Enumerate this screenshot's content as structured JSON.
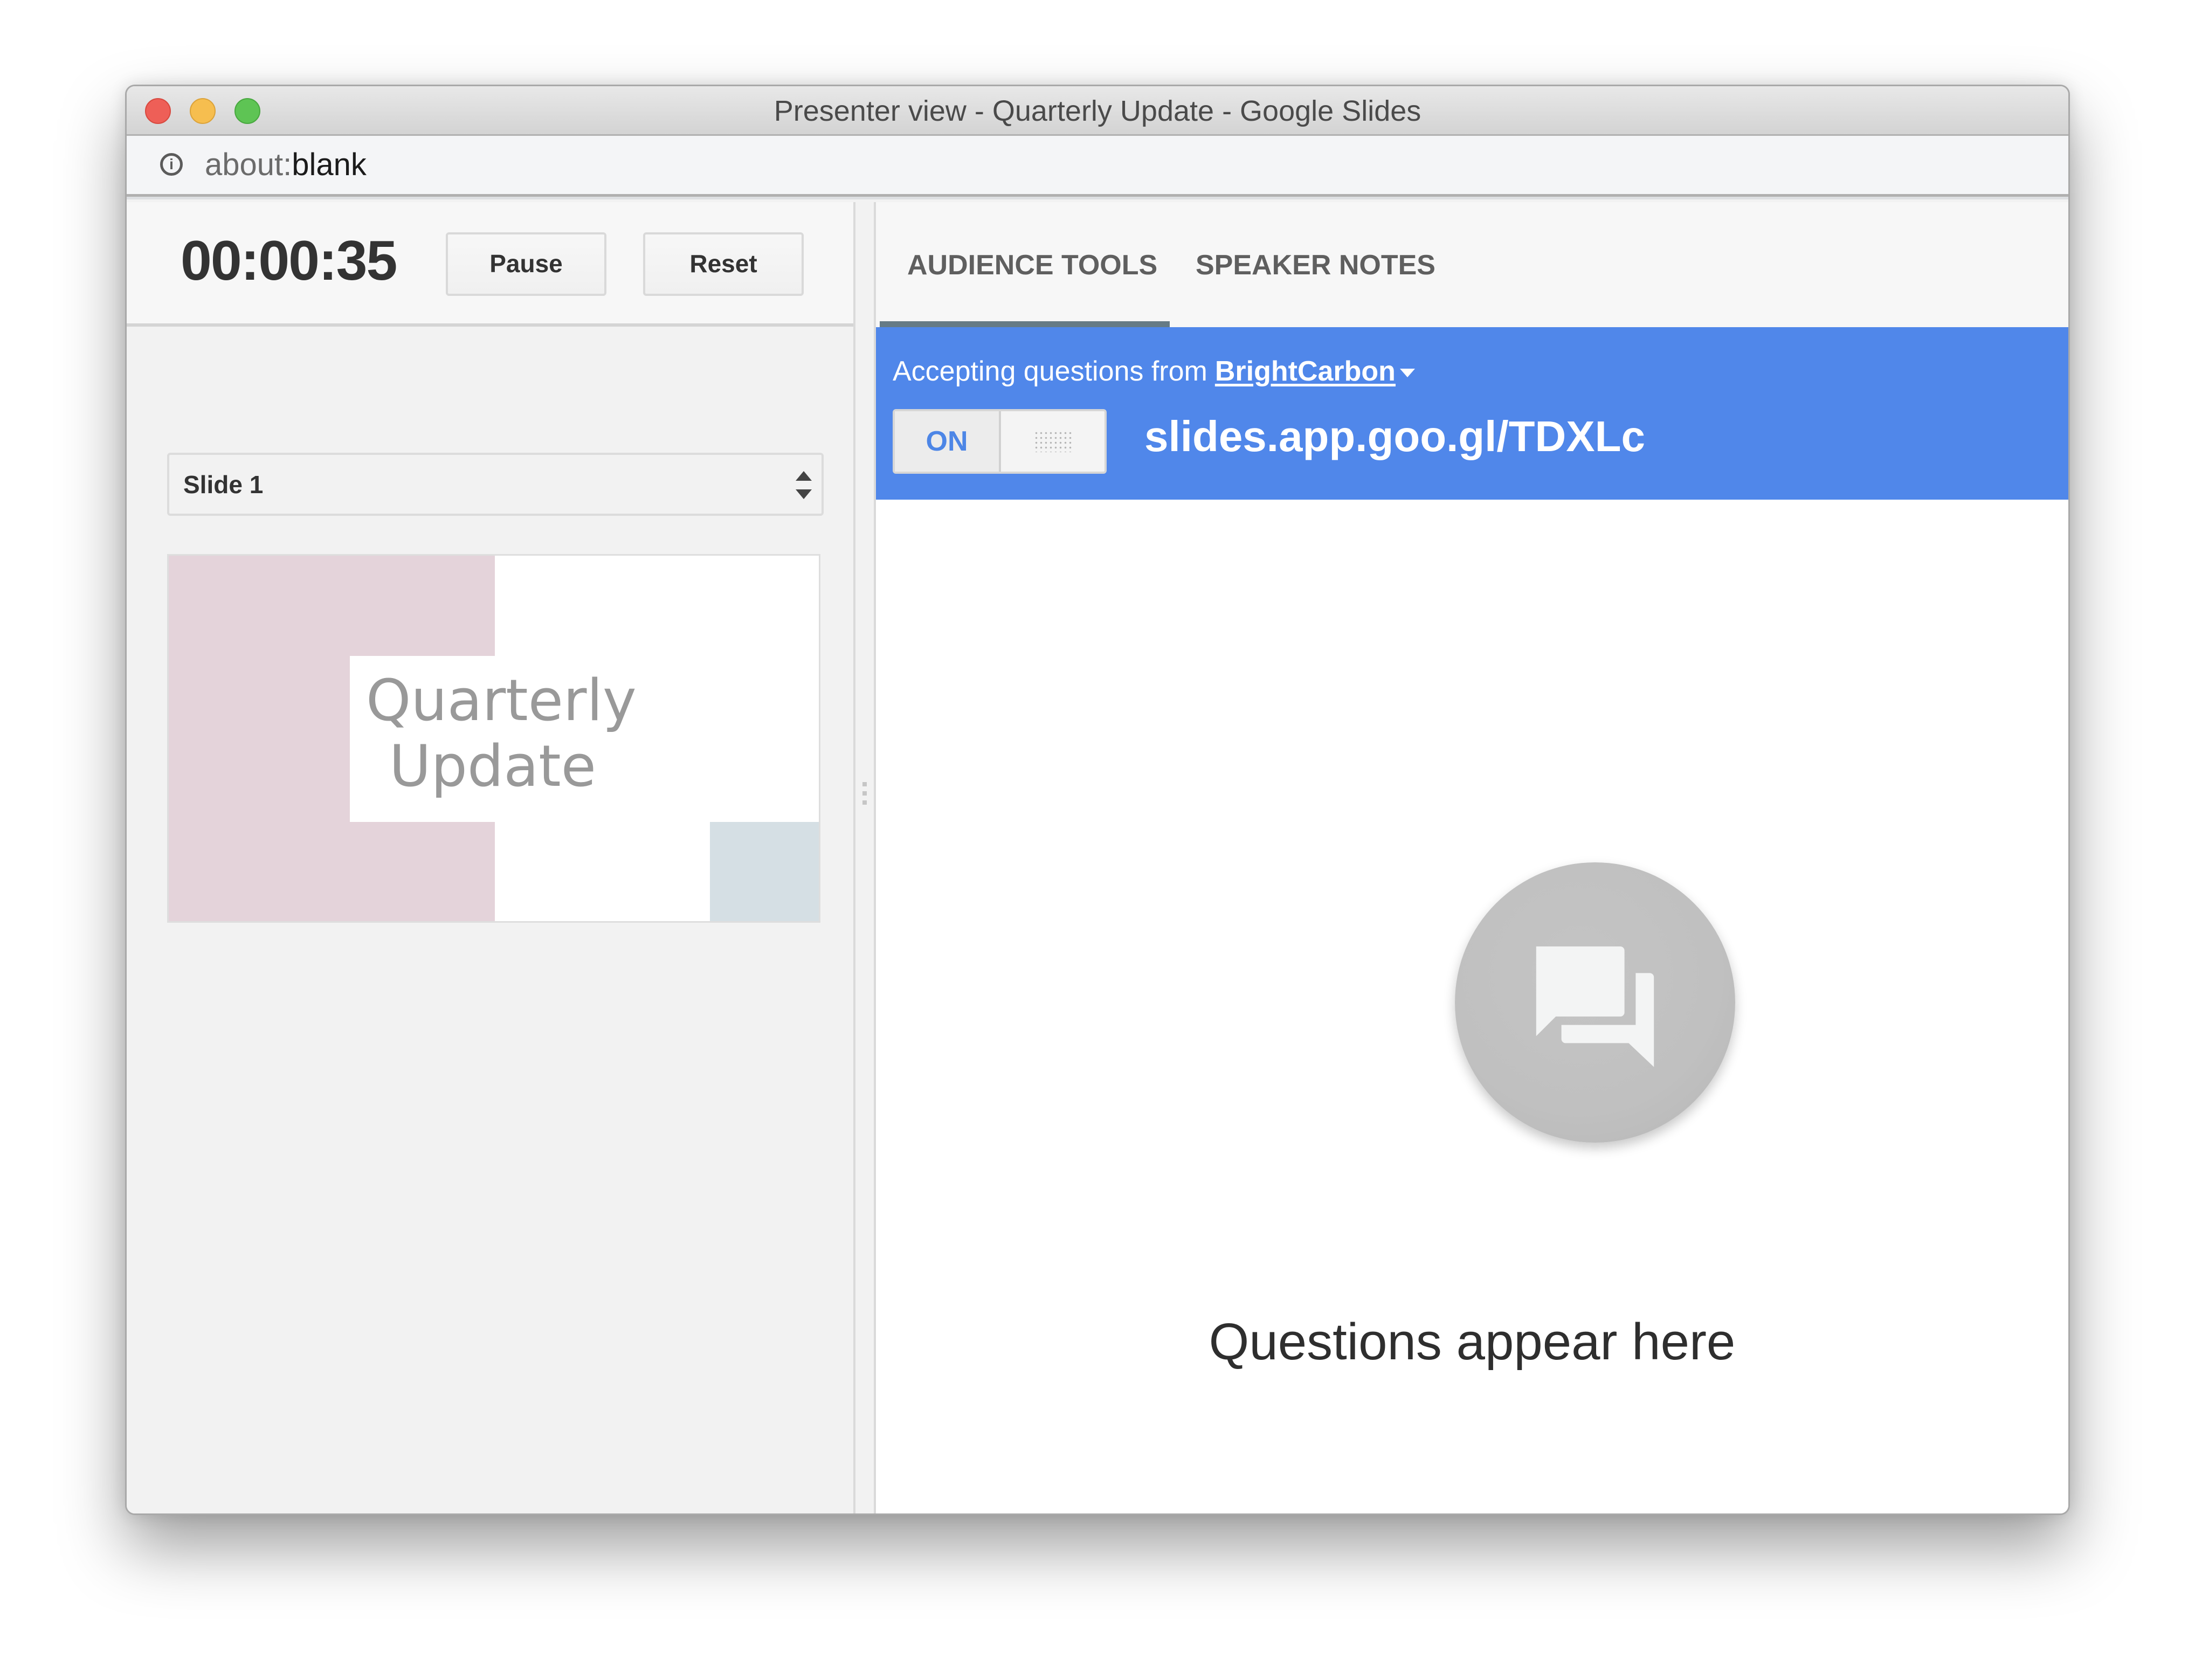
{
  "window": {
    "title": "Presenter view - Quarterly Update - Google Slides",
    "traffic_lights": [
      "close",
      "minimize",
      "zoom"
    ]
  },
  "address_bar": {
    "icon": "info-icon",
    "url_scheme": "about:",
    "url_rest": "blank"
  },
  "timer": {
    "elapsed": "00:00:35",
    "pause_label": "Pause",
    "reset_label": "Reset"
  },
  "slide_selector": {
    "selected": "Slide 1"
  },
  "slide_preview": {
    "title_line1": "Quarterly",
    "title_line2": "Update",
    "colors": {
      "pink_block": "#e4d3da",
      "blue_block": "#d5dfe4",
      "title_text": "#999999"
    }
  },
  "tabs": [
    {
      "label": "AUDIENCE TOOLS",
      "active": true
    },
    {
      "label": "SPEAKER NOTES",
      "active": false
    }
  ],
  "audience_tools": {
    "accepting_label": "Accepting questions from",
    "organization": "BrightCarbon",
    "toggle_state": "ON",
    "qa_url": "slides.app.goo.gl/TDXLc",
    "empty_state_icon": "chat-bubbles-icon",
    "empty_state_text": "Questions appear here",
    "accent_color": "#5087ea"
  }
}
